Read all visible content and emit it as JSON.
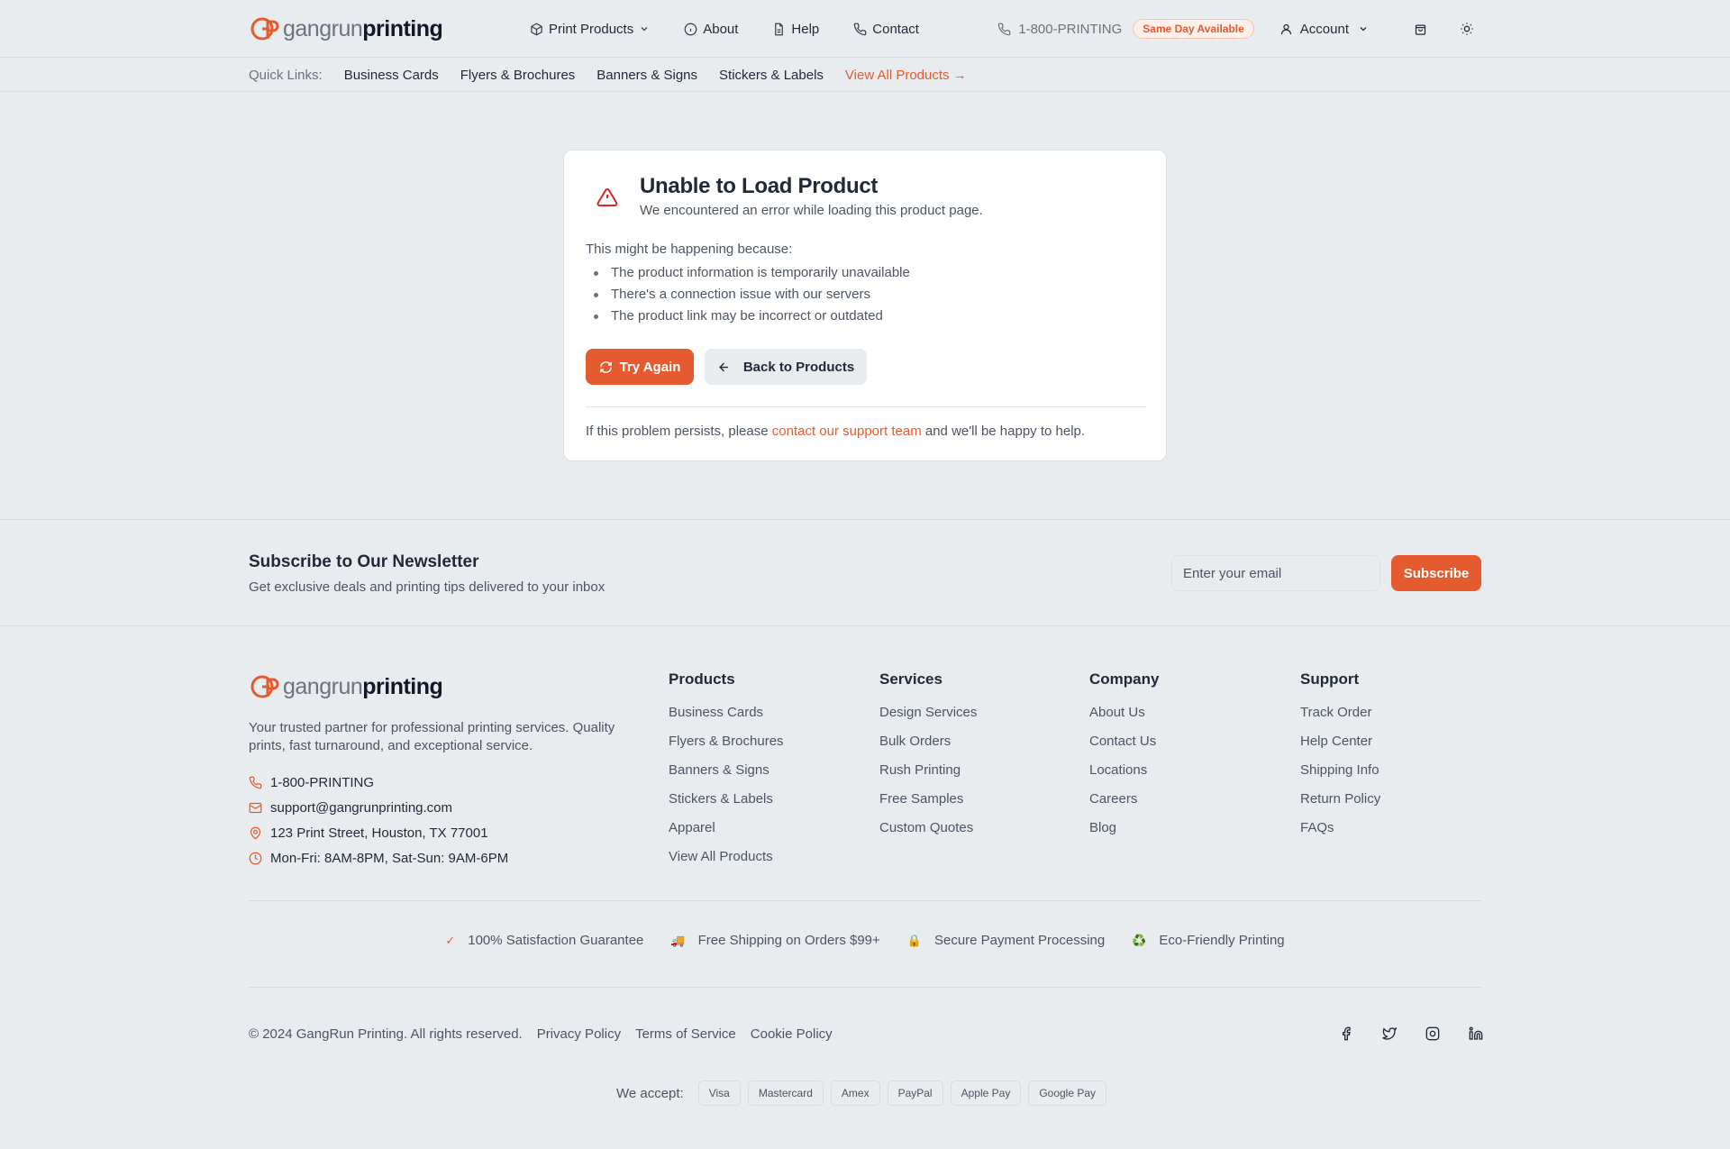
{
  "brand": {
    "name_part1": "gangrun",
    "name_part2": "printing",
    "accent": "#e45b2f"
  },
  "header": {
    "nav": [
      {
        "label": "Print Products",
        "icon": "box-icon"
      },
      {
        "label": "About",
        "icon": "info-icon"
      },
      {
        "label": "Help",
        "icon": "file-icon"
      },
      {
        "label": "Contact",
        "icon": "phone-icon"
      }
    ],
    "phone": "1-800-PRINTING",
    "badge": "Same Day Available",
    "account": "Account"
  },
  "quick_links": {
    "label": "Quick Links:",
    "items": [
      "Business Cards",
      "Flyers & Brochures",
      "Banners & Signs",
      "Stickers & Labels"
    ],
    "view_all": "View All Products →"
  },
  "error": {
    "title": "Unable to Load Product",
    "subtitle": "We encountered an error while loading this product page.",
    "why": "This might be happening because:",
    "reasons": [
      "The product information is temporarily unavailable",
      "There's a connection issue with our servers",
      "The product link may be incorrect or outdated"
    ],
    "try_again": "Try Again",
    "back": "Back to Products",
    "help_prefix": "If this problem persists, please",
    "help_link": "contact our support team",
    "help_suffix": "and we'll be happy to help."
  },
  "newsletter": {
    "title": "Subscribe to Our Newsletter",
    "subtitle": "Get exclusive deals and printing tips delivered to your inbox",
    "placeholder": "Enter your email",
    "button": "Subscribe"
  },
  "footer": {
    "tagline": "Your trusted partner for professional printing services. Quality prints, fast turnaround, and exceptional service.",
    "contact": {
      "phone": "1-800-PRINTING",
      "email": "support@gangrunprinting.com",
      "address": "123 Print Street, Houston, TX 77001",
      "hours": "Mon-Fri: 8AM-8PM, Sat-Sun: 9AM-6PM"
    },
    "columns": [
      {
        "title": "Products",
        "links": [
          "Business Cards",
          "Flyers & Brochures",
          "Banners & Signs",
          "Stickers & Labels",
          "Apparel",
          "View All Products"
        ]
      },
      {
        "title": "Services",
        "links": [
          "Design Services",
          "Bulk Orders",
          "Rush Printing",
          "Free Samples",
          "Custom Quotes"
        ]
      },
      {
        "title": "Company",
        "links": [
          "About Us",
          "Contact Us",
          "Locations",
          "Careers",
          "Blog"
        ]
      },
      {
        "title": "Support",
        "links": [
          "Track Order",
          "Help Center",
          "Shipping Info",
          "Return Policy",
          "FAQs"
        ]
      }
    ],
    "trust": [
      {
        "icon": "✓",
        "label": "100% Satisfaction Guarantee"
      },
      {
        "icon": "🚚",
        "label": "Free Shipping on Orders $99+"
      },
      {
        "icon": "🔒",
        "label": "Secure Payment Processing"
      },
      {
        "icon": "♻️",
        "label": "Eco-Friendly Printing"
      }
    ],
    "copyright": "© 2024 GangRun Printing. All rights reserved.",
    "legal": [
      "Privacy Policy",
      "Terms of Service",
      "Cookie Policy"
    ],
    "accept_label": "We accept:",
    "payment_methods": [
      "Visa",
      "Mastercard",
      "Amex",
      "PayPal",
      "Apple Pay",
      "Google Pay"
    ]
  }
}
